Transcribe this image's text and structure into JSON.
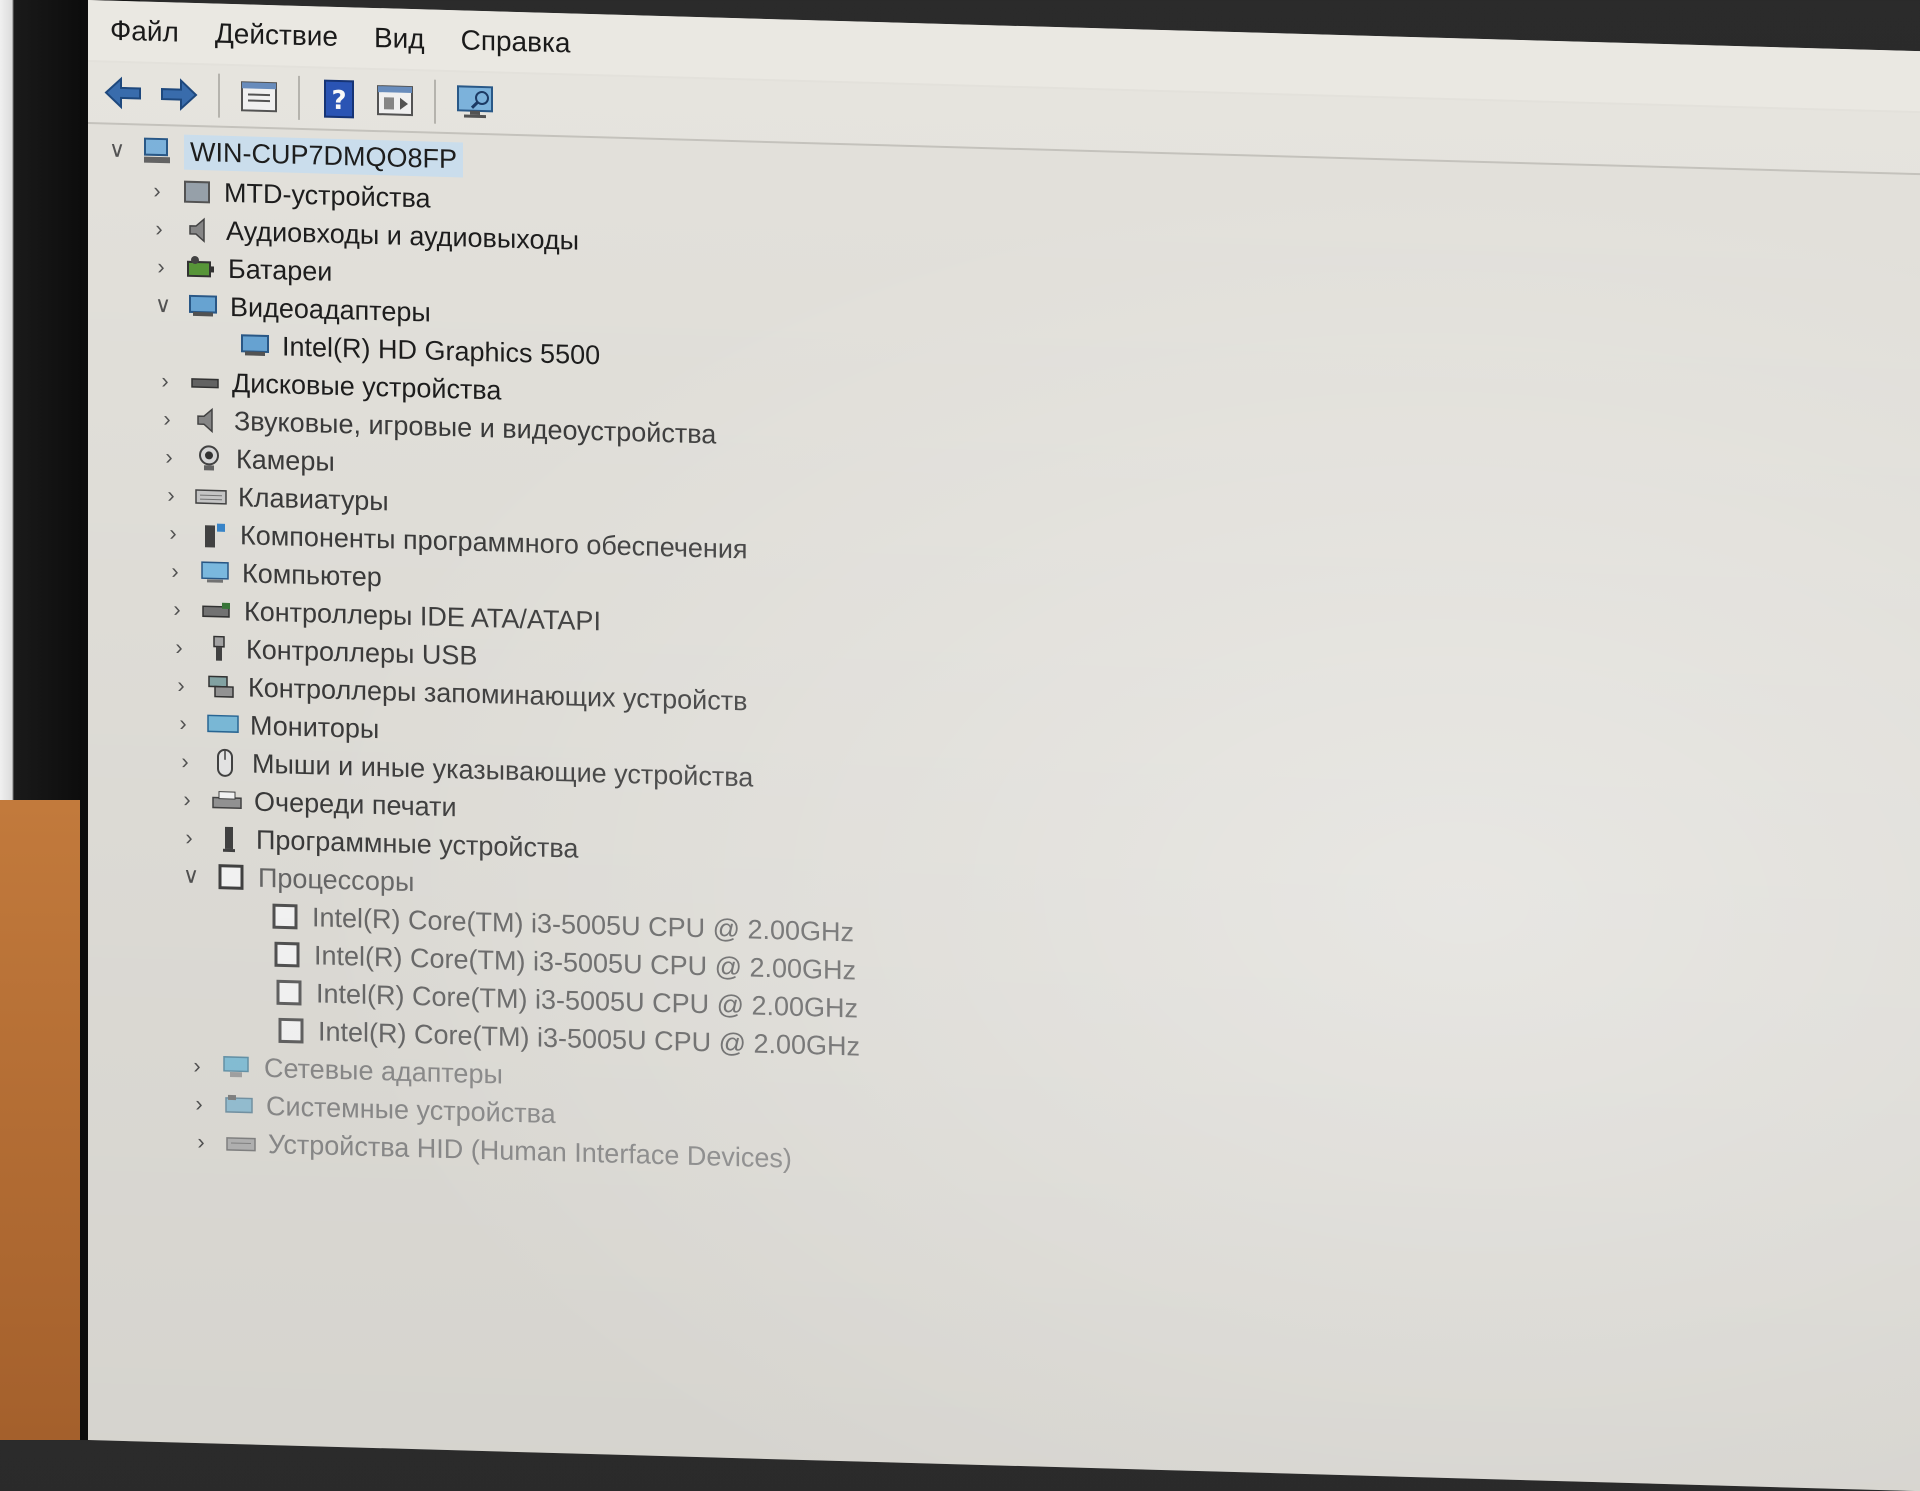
{
  "menu": [
    "Файл",
    "Действие",
    "Вид",
    "Справка"
  ],
  "toolbar": {
    "icons": [
      "back-arrow-icon",
      "forward-arrow-icon",
      "properties-icon",
      "help-icon",
      "view-icon",
      "monitor-icon"
    ]
  },
  "tree": {
    "root": "WIN-CUP7DMQO8FP",
    "categories": [
      {
        "label": "MTD-устройства",
        "expanded": false
      },
      {
        "label": "Аудиовходы и аудиовыходы",
        "expanded": false
      },
      {
        "label": "Батареи",
        "expanded": false
      },
      {
        "label": "Видеоадаптеры",
        "expanded": true,
        "children": [
          "Intel(R) HD Graphics 5500"
        ]
      },
      {
        "label": "Дисковые устройства",
        "expanded": false
      },
      {
        "label": "Звуковые, игровые и видеоустройства",
        "expanded": false
      },
      {
        "label": "Камеры",
        "expanded": false
      },
      {
        "label": "Клавиатуры",
        "expanded": false
      },
      {
        "label": "Компоненты программного обеспечения",
        "expanded": false
      },
      {
        "label": "Компьютер",
        "expanded": false
      },
      {
        "label": "Контроллеры IDE ATA/ATAPI",
        "expanded": false
      },
      {
        "label": "Контроллеры USB",
        "expanded": false
      },
      {
        "label": "Контроллеры запоминающих устройств",
        "expanded": false
      },
      {
        "label": "Мониторы",
        "expanded": false
      },
      {
        "label": "Мыши и иные указывающие устройства",
        "expanded": false
      },
      {
        "label": "Очереди печати",
        "expanded": false
      },
      {
        "label": "Программные устройства",
        "expanded": false
      },
      {
        "label": "Процессоры",
        "expanded": true,
        "children": [
          "Intel(R) Core(TM) i3-5005U CPU @ 2.00GHz",
          "Intel(R) Core(TM) i3-5005U CPU @ 2.00GHz",
          "Intel(R) Core(TM) i3-5005U CPU @ 2.00GHz",
          "Intel(R) Core(TM) i3-5005U CPU @ 2.00GHz"
        ]
      },
      {
        "label": "Сетевые адаптеры",
        "expanded": false
      },
      {
        "label": "Системные устройства",
        "expanded": false
      },
      {
        "label": "Устройства HID (Human Interface Devices)",
        "expanded": false
      }
    ]
  }
}
